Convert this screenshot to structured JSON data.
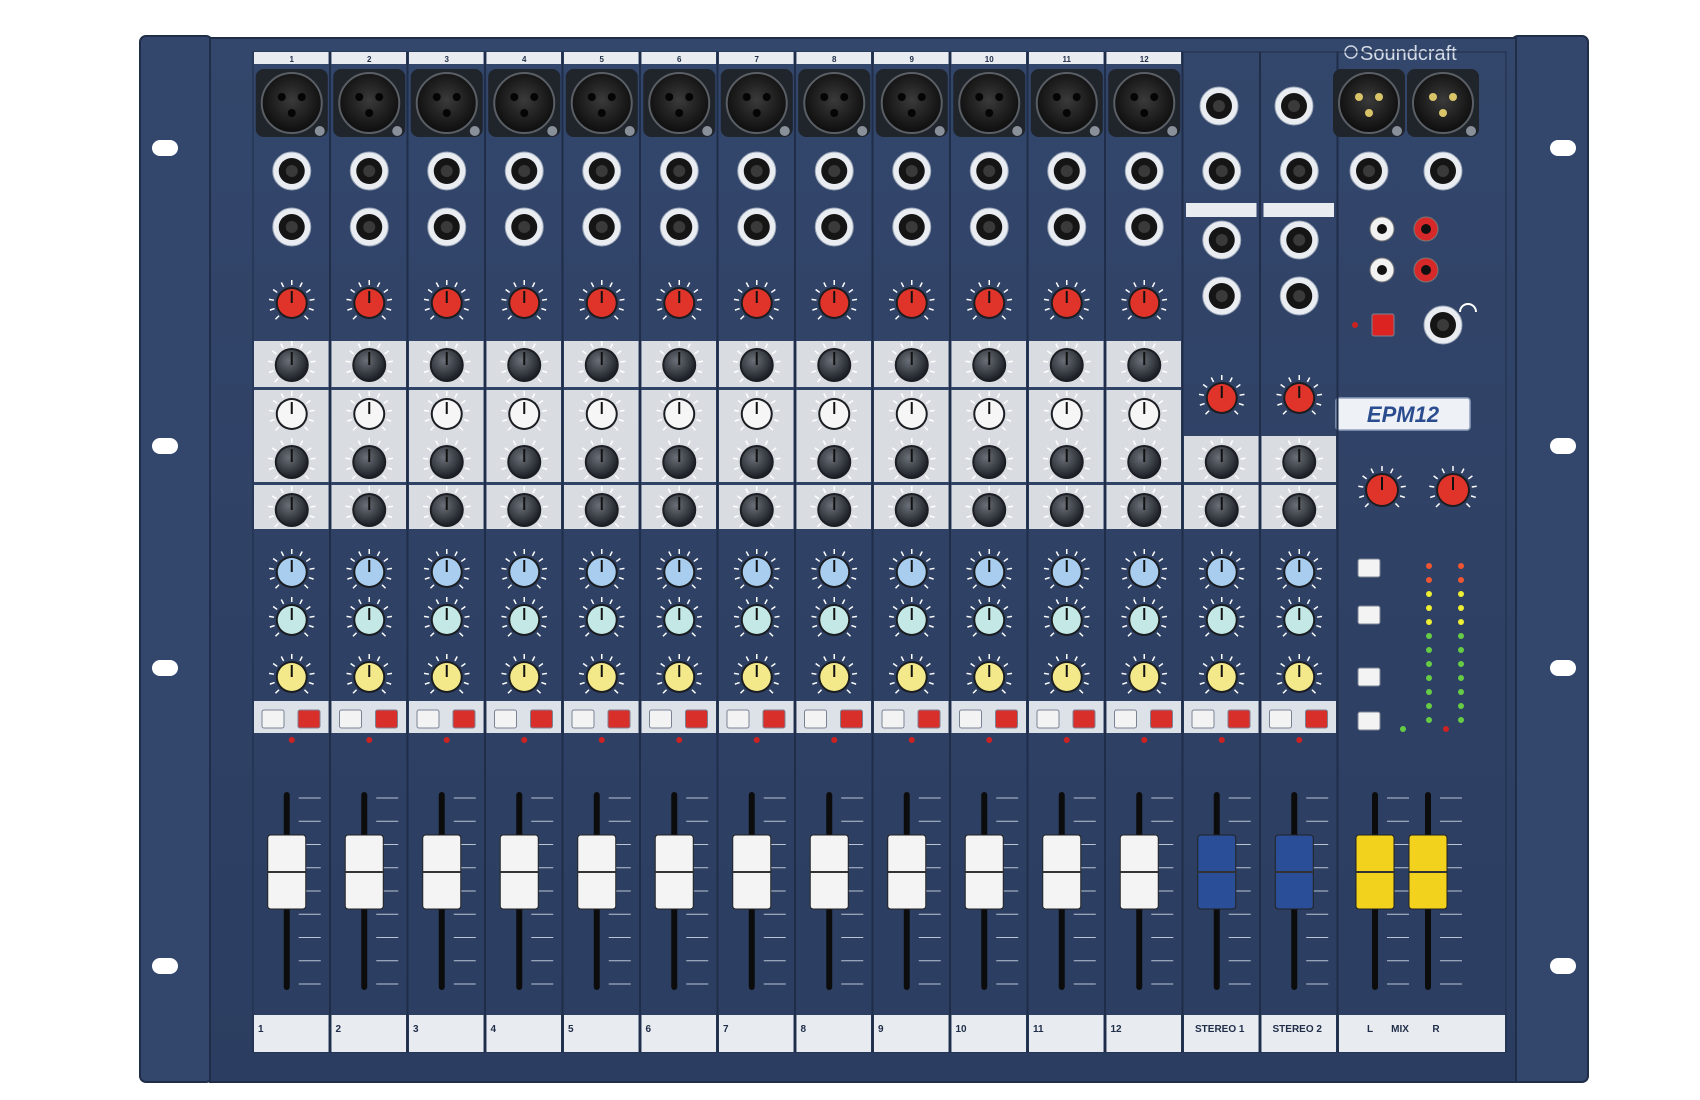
{
  "brand": {
    "name": "Soundcraft",
    "model": "EPM12"
  },
  "channels": [
    {
      "number": "1",
      "strip_label": "1"
    },
    {
      "number": "2",
      "strip_label": "2"
    },
    {
      "number": "3",
      "strip_label": "3"
    },
    {
      "number": "4",
      "strip_label": "4"
    },
    {
      "number": "5",
      "strip_label": "5"
    },
    {
      "number": "6",
      "strip_label": "6"
    },
    {
      "number": "7",
      "strip_label": "7"
    },
    {
      "number": "8",
      "strip_label": "8"
    },
    {
      "number": "9",
      "strip_label": "9"
    },
    {
      "number": "10",
      "strip_label": "10"
    },
    {
      "number": "11",
      "strip_label": "11"
    },
    {
      "number": "12",
      "strip_label": "12"
    }
  ],
  "stereo_channels": [
    {
      "name": "STEREO 1",
      "strip_label": "STEREO 1"
    },
    {
      "name": "STEREO 2",
      "strip_label": "STEREO 2"
    }
  ],
  "master": {
    "strip_label_left": "L",
    "strip_label_center": "MIX",
    "strip_label_right": "R"
  },
  "colors": {
    "panel": "#2f4266",
    "panel_dark": "#25365a",
    "rack_ear": "#35496e",
    "eq_band": "#d9dce1",
    "gain_knob": "#e0342b",
    "aux1_knob": "#a8cdee",
    "aux2_knob": "#c3e8e6",
    "pan_knob": "#f3e98a",
    "mute_button": "#d82f2a",
    "stereo_fader": "#2a4f98",
    "master_fader": "#f2d21c",
    "channel_fader": "#f4f4f4"
  }
}
